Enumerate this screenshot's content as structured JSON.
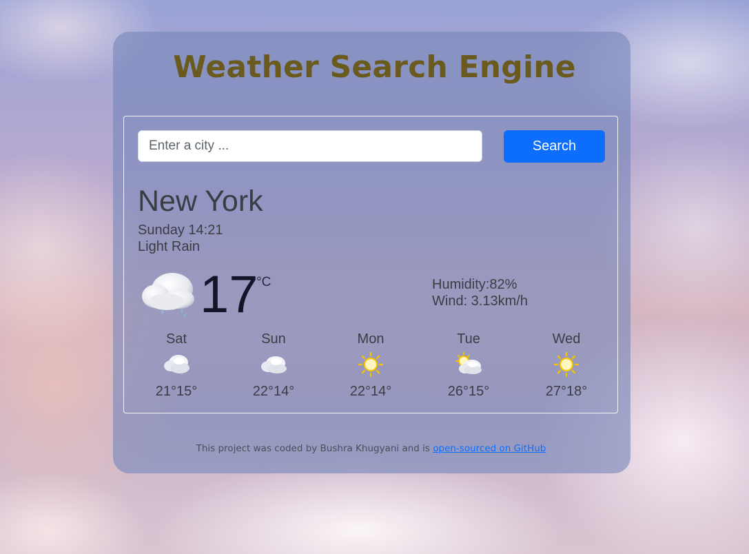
{
  "header": {
    "title": "Weather Search Engine"
  },
  "search": {
    "placeholder": "Enter a city ...",
    "value": "",
    "button_label": "Search"
  },
  "current": {
    "city": "New York",
    "date": "Sunday 14:21",
    "description": "Light Rain",
    "icon": "rain-cloud-icon",
    "temperature": "17",
    "unit": "°C",
    "humidity": "Humidity:82%",
    "wind": "Wind: 3.13km/h"
  },
  "forecast": [
    {
      "day": "Sat",
      "temps": "21°15°",
      "icon": "cloud-icon"
    },
    {
      "day": "Sun",
      "temps": "22°14°",
      "icon": "cloud-icon"
    },
    {
      "day": "Mon",
      "temps": "22°14°",
      "icon": "sun-icon"
    },
    {
      "day": "Tue",
      "temps": "26°15°",
      "icon": "partly-cloudy-icon"
    },
    {
      "day": "Wed",
      "temps": "27°18°",
      "icon": "sun-icon"
    }
  ],
  "footer": {
    "text": "This project was coded by Bushra Khugyani and is ",
    "link_label": "open-sourced on GitHub"
  },
  "colors": {
    "title": "#6b5a1e",
    "button": "#0d6efd",
    "link": "#0d6efd",
    "sun": "#f5c400"
  }
}
